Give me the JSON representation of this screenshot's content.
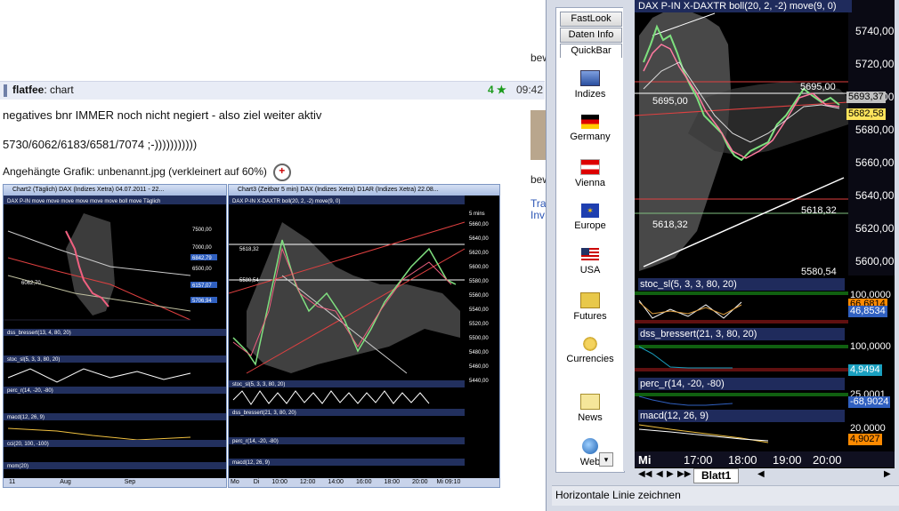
{
  "forum": {
    "post_user": "flatfee",
    "post_subject": ": chart",
    "score": "4",
    "time": "09:42",
    "line1": "negatives bnr IMMER noch nicht negiert - also ziel weiter aktiv",
    "line2": "5730/6062/6183/6581/7074 ;-)))))))))))",
    "attachment_label": "Angehängte Grafik: unbenannt.jpg (verkleinert auf 60%)",
    "side_bew1": "bew",
    "side_bew2": "bew",
    "side_tra": "Tra",
    "side_inv": "Inv"
  },
  "thumb_left": {
    "title": "Chart2 (Täglich)  DAX (Indizes Xetra) 04.07.2011 - 22...",
    "inner_title": "DAX P-IN  move move move move move move boll move  Täglich",
    "labels": [
      "7500,00",
      "7000,00",
      "6842,79",
      "6500,00",
      "6062,70",
      "6157,07",
      "5706,94",
      "dss_bressert(13, 4, 80, 20)",
      "stoc_sl(5, 3, 3, 80, 20)",
      "perc_r(14, -20, -80)",
      "macd(12, 26, 9)",
      "cci(20, 100, -100)",
      "mom(20)"
    ],
    "xaxis": [
      "11",
      "Aug",
      "Sep"
    ]
  },
  "thumb_mid": {
    "title": "Chart3 (Zeitbar 5 min)  DAX (Indizes Xetra) D1AR (Indizes Xetra) 22.08...",
    "inner_title": "DAX P-IN  X-DAXTR boll(20, 2, -2) move(9, 0)",
    "labels": [
      "5 mins",
      "5660,00",
      "5640,00",
      "5620,00",
      "5600,00",
      "5580,00",
      "5560,00",
      "5540,00",
      "5520,00",
      "5500,00",
      "5480,00",
      "5460,00",
      "5440,00",
      "5618,32",
      "5580,54",
      "stoc_sl(5, 3, 3, 80, 20)",
      "dss_bressert(21, 3, 80, 20)",
      "perc_r(14, -20, -80)",
      "macd(12, 26, 9)"
    ],
    "xaxis": [
      "Mo",
      "Di",
      "10:00",
      "12:00",
      "14:00",
      "16:00",
      "18:00",
      "20:00",
      "Mi 09:10"
    ]
  },
  "app": {
    "tabs": {
      "fastlook": "FastLook",
      "daten": "Daten Info",
      "quickbar": "QuickBar"
    },
    "quick_items": [
      {
        "label": "Indizes",
        "icon": "indices-icon"
      },
      {
        "label": "Germany",
        "icon": "germany-flag-icon"
      },
      {
        "label": "Vienna",
        "icon": "austria-flag-icon"
      },
      {
        "label": "Europe",
        "icon": "eu-flag-icon"
      },
      {
        "label": "USA",
        "icon": "usa-flag-icon"
      },
      {
        "label": "Futures",
        "icon": "futures-icon"
      },
      {
        "label": "Currencies",
        "icon": "coins-icon"
      },
      {
        "label": "News",
        "icon": "news-icon"
      },
      {
        "label": "Web",
        "icon": "globe-icon"
      }
    ],
    "chart_title": "DAX P-IN  X-DAXTR boll(20, 2, -2) move(9, 0)",
    "price_axis": [
      "5740,00",
      "5720,00",
      "5700,00",
      "5680,00",
      "5660,00",
      "5640,00",
      "5620,00",
      "5600,00"
    ],
    "tags": {
      "level_5695_left": "5695,00",
      "level_5695_right": "5695,00",
      "tag_5693": "5693,37",
      "tag_5682": "5682,58",
      "level_5618": "5618,32",
      "level_5618_left": "5618,32",
      "level_5580": "5580,54"
    },
    "indicators": [
      {
        "name": "stoc_sl(5, 3, 3, 80, 20)",
        "v1": "100,0000",
        "v2": "66,6814",
        "v3": "46,8534"
      },
      {
        "name": "dss_bressert(21, 3, 80, 20)",
        "v1": "100,0000",
        "v2": "4,9494"
      },
      {
        "name": "perc_r(14, -20, -80)",
        "v1": "25,0001",
        "v2": "-68,9024"
      },
      {
        "name": "macd(12, 26, 9)",
        "v1": "20,0000",
        "v2": "4,9027"
      }
    ],
    "xaxis": [
      "Mi",
      "17:00",
      "18:00",
      "19:00",
      "20:00"
    ],
    "sheet_tab": "Blatt1",
    "status": "Horizontale Linie zeichnen",
    "colors": {
      "accent": "#1f2b5c",
      "bg": "#000000",
      "up": "#7ee07e",
      "down": "#ff7aa0"
    }
  }
}
